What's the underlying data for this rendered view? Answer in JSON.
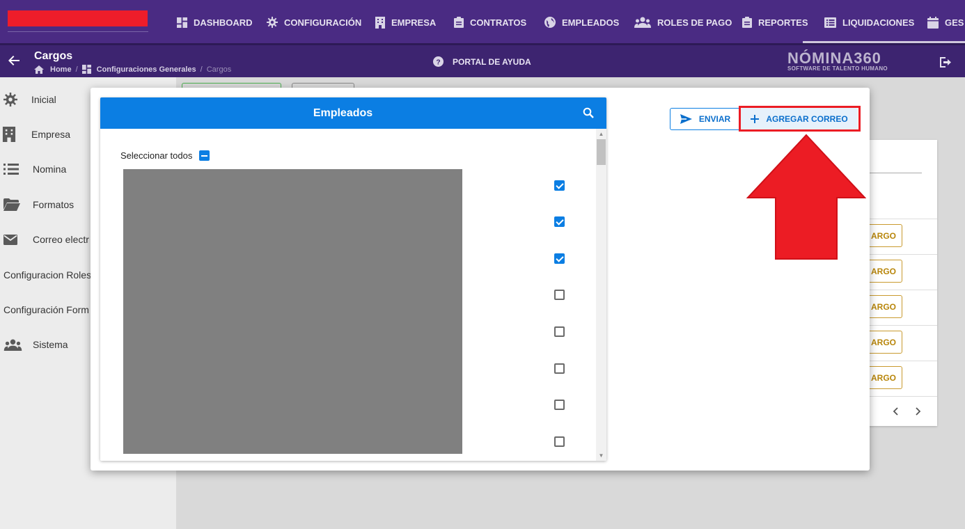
{
  "topnav": {
    "items": [
      {
        "label": "DASHBOARD",
        "icon": "dashboard-icon"
      },
      {
        "label": "CONFIGURACIÓN",
        "icon": "gear-icon"
      },
      {
        "label": "EMPRESA",
        "icon": "building-icon"
      },
      {
        "label": "CONTRATOS",
        "icon": "clipboard-icon"
      },
      {
        "label": "EMPLEADOS",
        "icon": "globe-icon"
      },
      {
        "label": "ROLES DE PAGO",
        "icon": "users-icon"
      },
      {
        "label": "REPORTES",
        "icon": "clipboard-icon"
      },
      {
        "label": "LIQUIDACIONES",
        "icon": "list-icon"
      },
      {
        "label": "GES",
        "icon": "calendar-icon"
      }
    ]
  },
  "subheader": {
    "title": "Cargos",
    "breadcrumb": [
      "Home",
      "Configuraciones Generales",
      "Cargos"
    ],
    "help_label": "PORTAL DE AYUDA",
    "logo_main": "NÓMINA360",
    "logo_sub": "SOFTWARE DE TALENTO HUMANO"
  },
  "sidebar": {
    "items": [
      {
        "label": "Inicial",
        "icon": "gear-icon"
      },
      {
        "label": "Empresa",
        "icon": "building-icon"
      },
      {
        "label": "Nomina",
        "icon": "list-icon"
      },
      {
        "label": "Formatos",
        "icon": "folder-icon"
      },
      {
        "label": "Correo electr",
        "icon": "mail-icon"
      },
      {
        "label": "Configuracion Roles",
        "icon": ""
      },
      {
        "label": "Configuración Form",
        "icon": ""
      },
      {
        "label": "Sistema",
        "icon": "users-icon"
      }
    ]
  },
  "background": {
    "cargo_label": "ARGO"
  },
  "modal": {
    "employees_title": "Empleados",
    "select_all_label": "Seleccionar todos",
    "checkboxes": [
      true,
      true,
      true,
      false,
      false,
      false,
      false,
      false
    ],
    "send_label": "ENVIAR",
    "add_email_label": "AGREGAR CORREO"
  },
  "colors": {
    "topnav": "#4a2b83",
    "primary": "#0b7ee3",
    "highlight": "#ec1c24",
    "cargo_button": "#c99a2e"
  }
}
